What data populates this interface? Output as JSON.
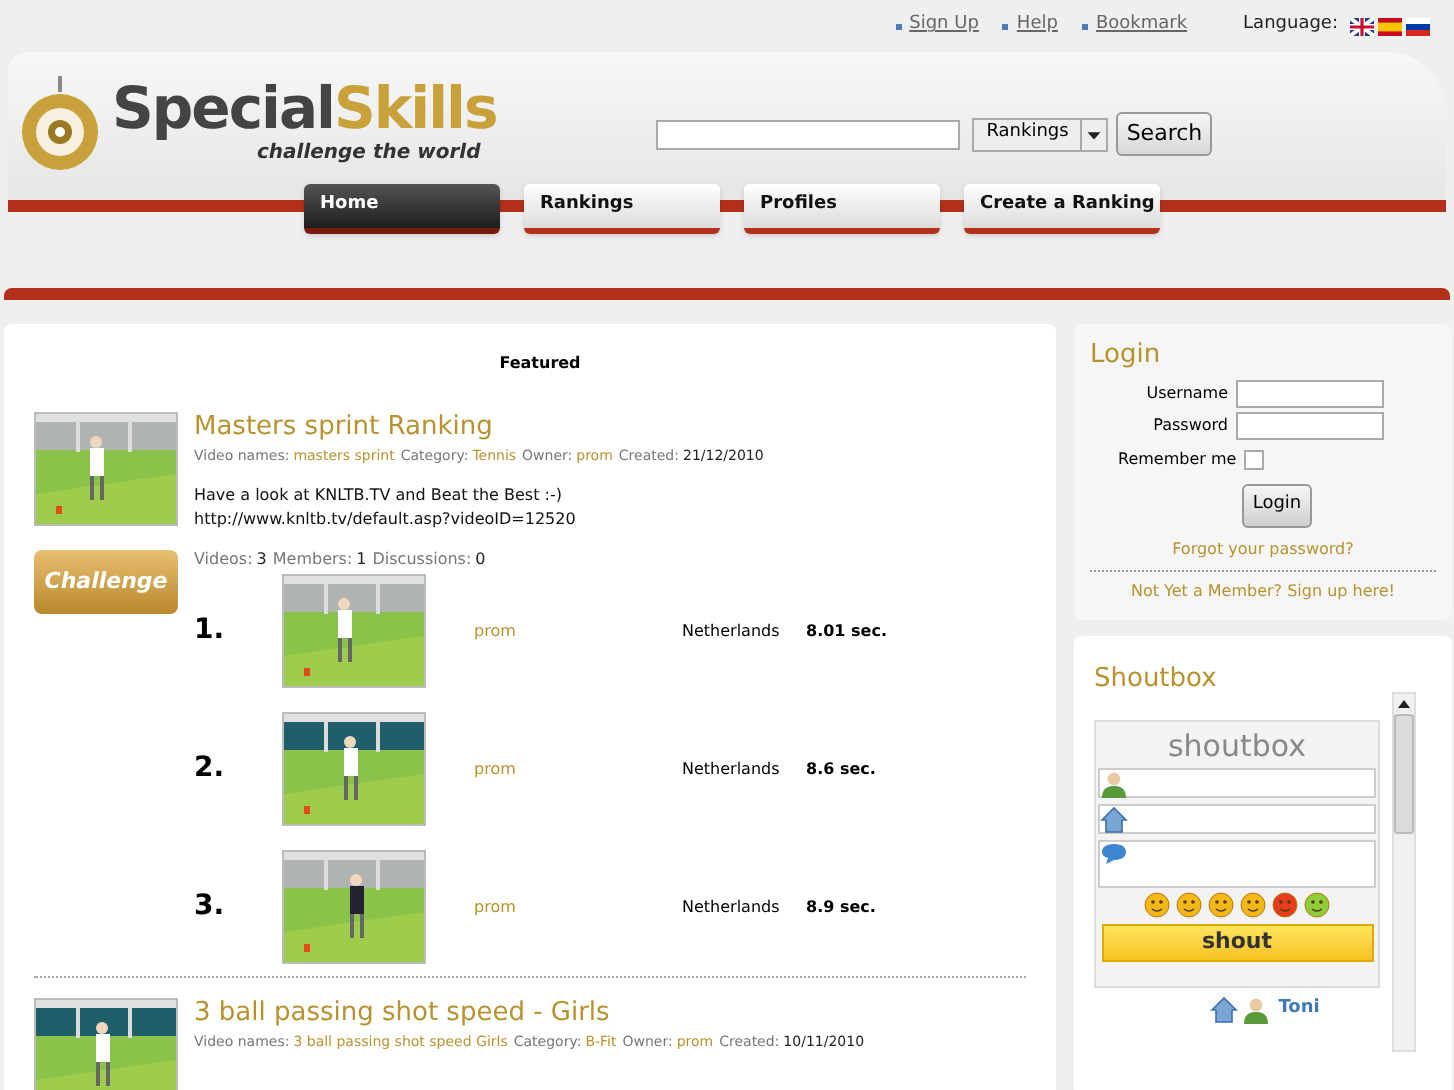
{
  "top_links": [
    "Sign Up",
    "Help",
    "Bookmark"
  ],
  "language_label": "Language:",
  "logo": {
    "word_1": "Special",
    "word_2": "Skills",
    "tagline": "challenge the world"
  },
  "search": {
    "dropdown": "Rankings",
    "button": "Search"
  },
  "nav": [
    {
      "label": "Home",
      "selected": true
    },
    {
      "label": "Rankings",
      "selected": false
    },
    {
      "label": "Profiles",
      "selected": false
    },
    {
      "label": "Create a Ranking",
      "selected": false
    }
  ],
  "featured_title": "Featured",
  "rankings": [
    {
      "title": "Masters sprint Ranking",
      "meta": [
        {
          "label": "Video names:",
          "value": "masters sprint",
          "kind": "link"
        },
        {
          "label": "Category:",
          "value": "Tennis",
          "kind": "link"
        },
        {
          "label": "Owner:",
          "value": "prom",
          "kind": "link"
        },
        {
          "label": "Created:",
          "value": "21/12/2010",
          "kind": "date"
        }
      ],
      "description": [
        "Have a look at KNLTB.TV and Beat the Best :-)",
        "http://www.knltb.tv/default.asp?videoID=12520"
      ],
      "stats": [
        {
          "label": "Videos:",
          "value": "3"
        },
        {
          "label": "Members:",
          "value": "1"
        },
        {
          "label": "Discussions:",
          "value": "0"
        }
      ],
      "badge": "Challenge",
      "entries": [
        {
          "rank": "1.",
          "user": "prom",
          "country": "Netherlands",
          "time": "8.01 sec."
        },
        {
          "rank": "2.",
          "user": "prom",
          "country": "Netherlands",
          "time": "8.6 sec."
        },
        {
          "rank": "3.",
          "user": "prom",
          "country": "Netherlands",
          "time": "8.9 sec."
        }
      ]
    },
    {
      "title": "3 ball passing shot speed - Girls",
      "meta": [
        {
          "label": "Video names:",
          "value": "3 ball passing shot speed Girls",
          "kind": "link"
        },
        {
          "label": "Category:",
          "value": "B-Fit",
          "kind": "link"
        },
        {
          "label": "Owner:",
          "value": "prom",
          "kind": "link"
        },
        {
          "label": "Created:",
          "value": "10/11/2010",
          "kind": "date"
        }
      ]
    }
  ],
  "login": {
    "title": "Login",
    "fields": [
      {
        "label": "Username"
      },
      {
        "label": "Password"
      }
    ],
    "remember_label": "Remember me",
    "remember_checked": false,
    "button": "Login",
    "forgot": "Forgot your password?",
    "signup": "Not Yet a Member? Sign up here!"
  },
  "shoutbox": {
    "title": "Shoutbox",
    "widget_title": "shoutbox",
    "button": "shout",
    "latest_name": "Toni"
  }
}
